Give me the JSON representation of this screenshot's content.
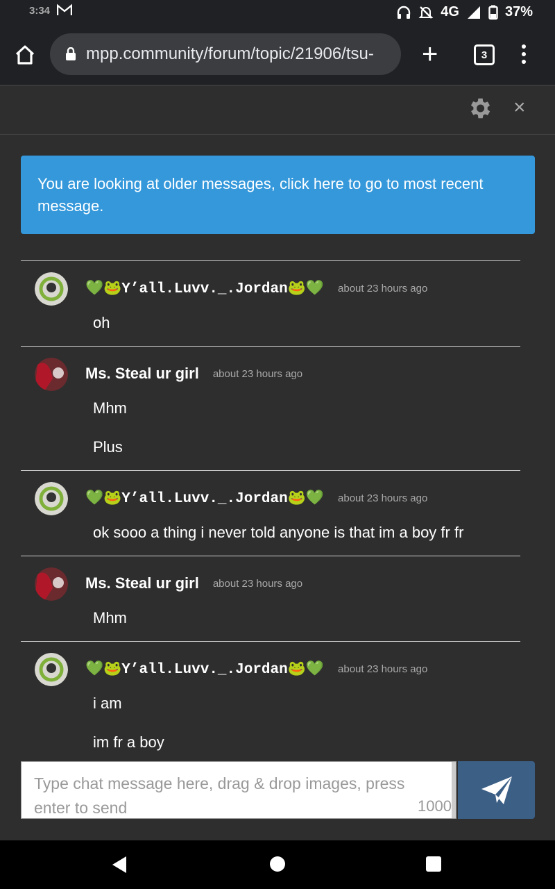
{
  "status_bar": {
    "time": "3:34",
    "network": "4G",
    "battery": "37%",
    "icons": [
      "gmail-icon",
      "headphones-icon",
      "muted-bell-icon",
      "signal-icon",
      "battery-icon"
    ]
  },
  "browser": {
    "url": "mpp.community/forum/topic/21906/tsu-",
    "tab_count": "3",
    "icons": [
      "home-icon",
      "lock-icon",
      "new-tab-icon",
      "tabs-icon",
      "menu-icon"
    ]
  },
  "chat": {
    "icons": [
      "gear-icon",
      "close-icon"
    ],
    "close_label": "×",
    "banner": "You are looking at older messages, click here to go to most recent message.",
    "messages": [
      {
        "name": "💚🐸Y’all.Luvv._.Jordan🐸💚",
        "time": "about 23 hours ago",
        "lines": [
          "oh"
        ]
      },
      {
        "name": "Ms. Steal ur girl",
        "time": "about 23 hours ago",
        "lines": [
          "Mhm",
          "Plus"
        ]
      },
      {
        "name": "💚🐸Y’all.Luvv._.Jordan🐸💚",
        "time": "about 23 hours ago",
        "lines": [
          "ok sooo a thing i never told anyone is that im a boy fr fr"
        ]
      },
      {
        "name": "Ms. Steal ur girl",
        "time": "about 23 hours ago",
        "lines": [
          "Mhm"
        ]
      },
      {
        "name": "💚🐸Y’all.Luvv._.Jordan🐸💚",
        "time": "about 23 hours ago",
        "lines": [
          "i am",
          "im fr a boy"
        ]
      }
    ],
    "input": {
      "placeholder": "Type chat message here, drag & drop images, press enter to send",
      "counter": "1000"
    },
    "send_icon": "send-icon"
  },
  "nav_bar": {
    "icons": [
      "back-icon",
      "home-circle-icon",
      "recents-icon"
    ]
  },
  "colors": {
    "banner": "#3498db",
    "send_button": "#3c5f86",
    "background": "#2e2e2e"
  }
}
